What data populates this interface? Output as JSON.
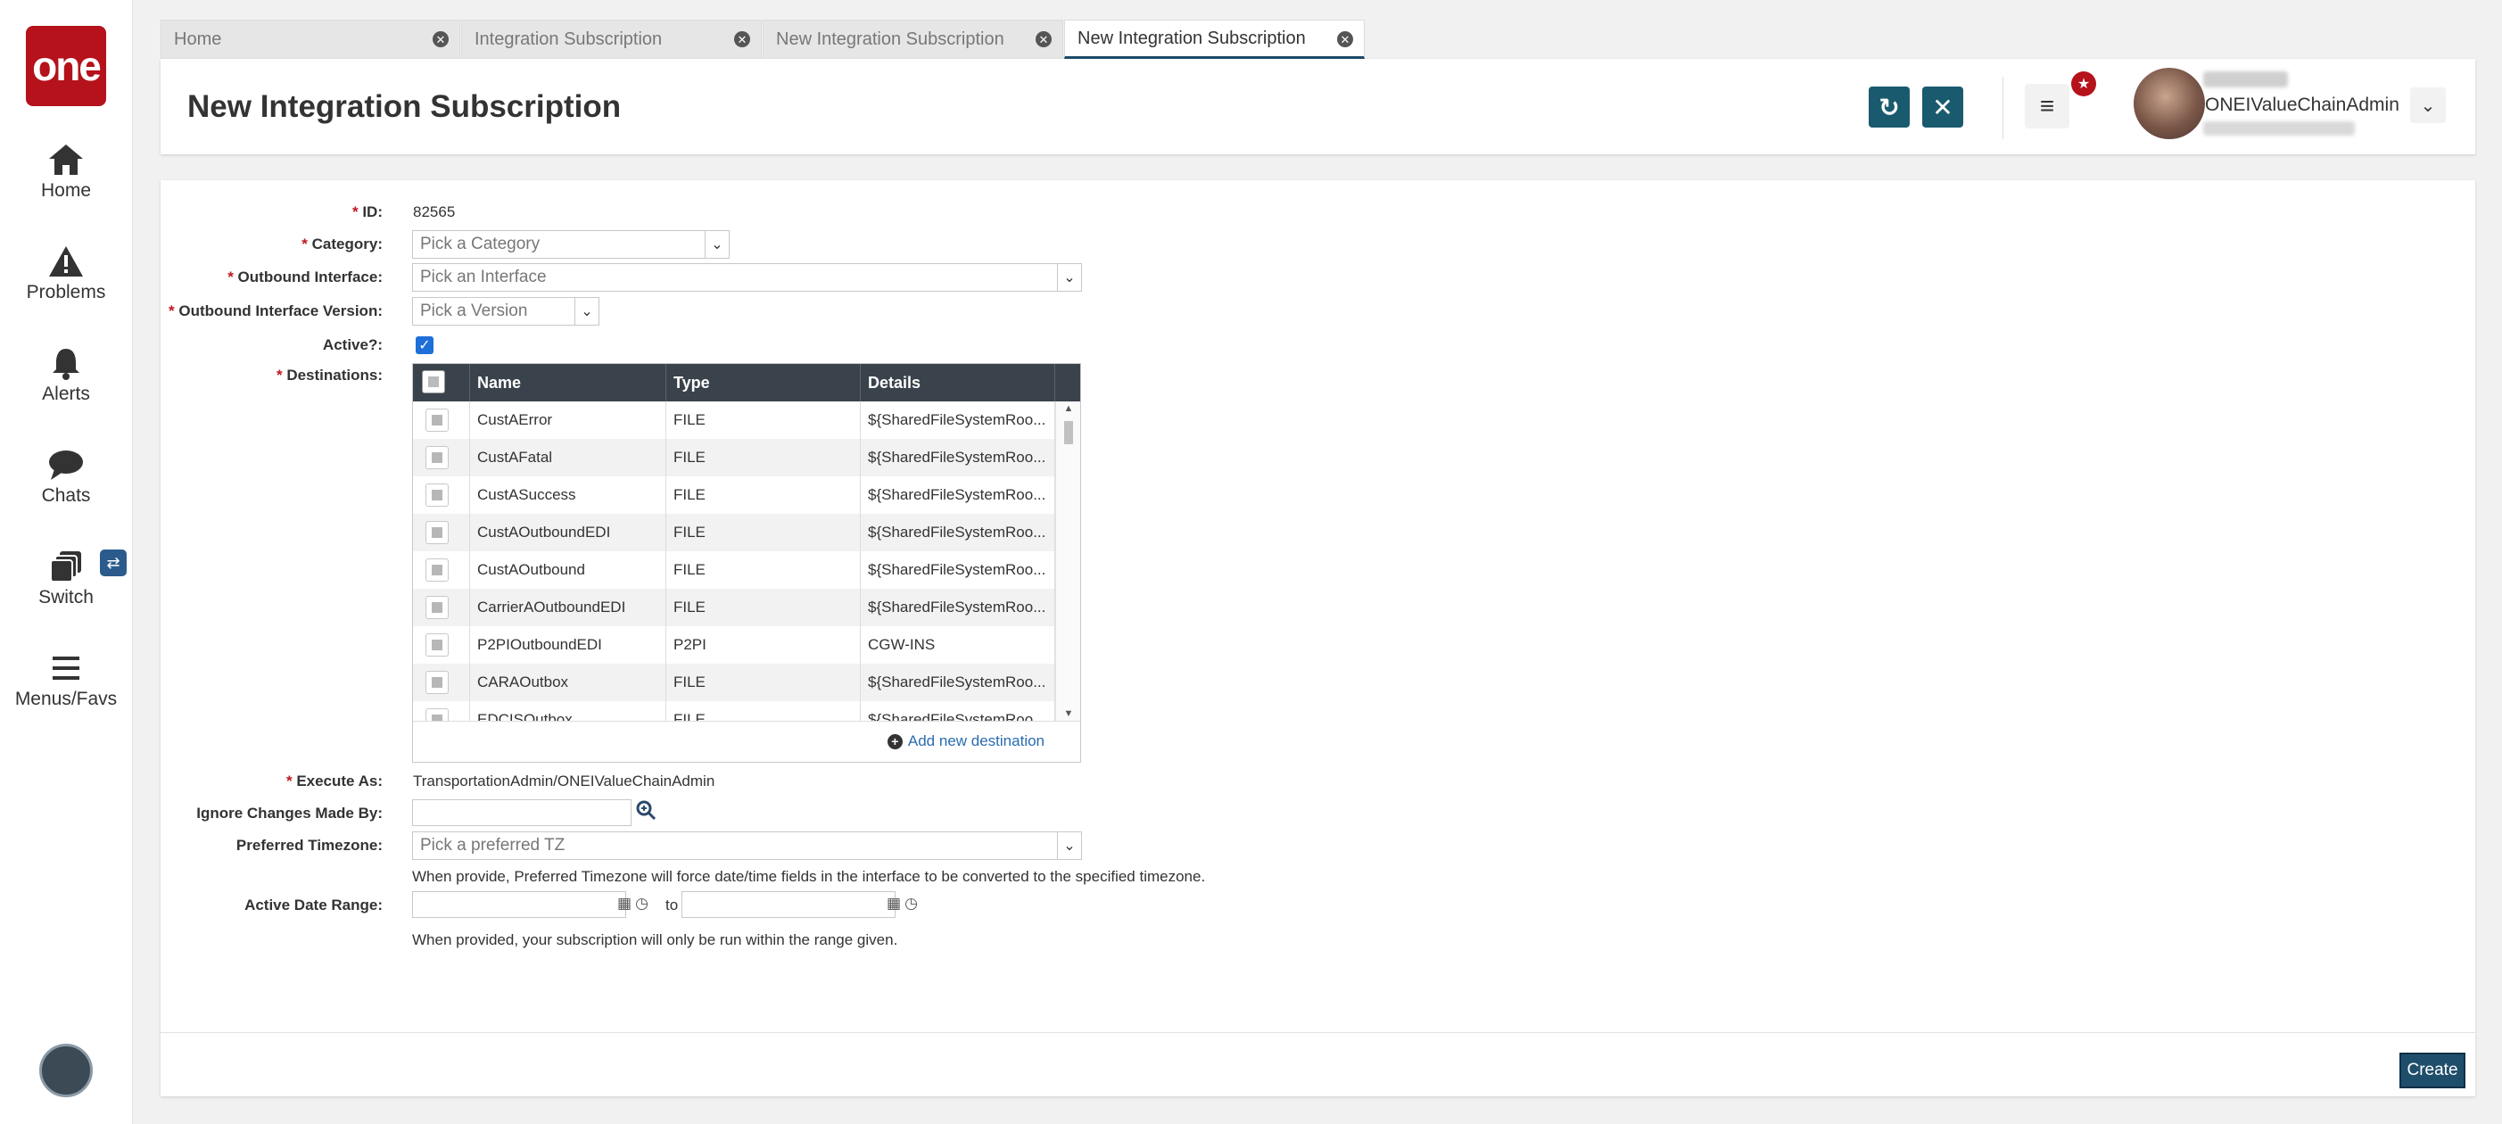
{
  "nav": {
    "logo": "one",
    "items": [
      {
        "label": "Home",
        "icon": "home-icon"
      },
      {
        "label": "Problems",
        "icon": "warning-icon"
      },
      {
        "label": "Alerts",
        "icon": "bell-icon"
      },
      {
        "label": "Chats",
        "icon": "chat-icon"
      },
      {
        "label": "Switch",
        "icon": "switch-icon"
      },
      {
        "label": "Menus/Favs",
        "icon": "hamburger-icon"
      }
    ],
    "switch_badge": "⇄"
  },
  "tabs": [
    {
      "label": "Home",
      "active": false
    },
    {
      "label": "Integration Subscription",
      "active": false
    },
    {
      "label": "New Integration Subscription",
      "active": false
    },
    {
      "label": "New Integration Subscription",
      "active": true
    }
  ],
  "header": {
    "title": "New Integration Subscription",
    "refresh_icon": "↻",
    "close_icon": "✕",
    "menu_icon": "≡",
    "notif_icon": "★",
    "user_role": "ONEIValueChainAdmin",
    "user_dropdown": "⌄"
  },
  "form": {
    "id": {
      "label": "ID:",
      "value": "82565"
    },
    "category": {
      "label": "Category:",
      "placeholder": "Pick a Category"
    },
    "outbound_interface": {
      "label": "Outbound Interface:",
      "placeholder": "Pick an Interface"
    },
    "outbound_interface_version": {
      "label": "Outbound Interface Version:",
      "placeholder": "Pick a Version"
    },
    "active": {
      "label": "Active?:",
      "checked": true,
      "checkmark": "✓"
    },
    "destinations": {
      "label": "Destinations:",
      "columns": [
        "Name",
        "Type",
        "Details"
      ],
      "rows": [
        {
          "name": "CustAError",
          "type": "FILE",
          "details": "${SharedFileSystemRoo..."
        },
        {
          "name": "CustAFatal",
          "type": "FILE",
          "details": "${SharedFileSystemRoo..."
        },
        {
          "name": "CustASuccess",
          "type": "FILE",
          "details": "${SharedFileSystemRoo..."
        },
        {
          "name": "CustAOutboundEDI",
          "type": "FILE",
          "details": "${SharedFileSystemRoo..."
        },
        {
          "name": "CustAOutbound",
          "type": "FILE",
          "details": "${SharedFileSystemRoo..."
        },
        {
          "name": "CarrierAOutboundEDI",
          "type": "FILE",
          "details": "${SharedFileSystemRoo..."
        },
        {
          "name": "P2PIOutboundEDI",
          "type": "P2PI",
          "details": "CGW-INS"
        },
        {
          "name": "CARAOutbox",
          "type": "FILE",
          "details": "${SharedFileSystemRoo..."
        },
        {
          "name": "EDCISOutbox",
          "type": "FILE",
          "details": "${SharedFileSystemRoo..."
        }
      ],
      "add_new": "Add new destination",
      "add_icon": "+"
    },
    "execute_as": {
      "label": "Execute As:",
      "value": "TransportationAdmin/ONEIValueChainAdmin"
    },
    "ignore_changes": {
      "label": "Ignore Changes Made By:",
      "value": ""
    },
    "preferred_timezone": {
      "label": "Preferred Timezone:",
      "placeholder": "Pick a preferred TZ",
      "help": "When provide, Preferred Timezone will force date/time fields in the interface to be converted to the specified timezone."
    },
    "active_date_range": {
      "label": "Active Date Range:",
      "to": "to",
      "help": "When provided, your subscription will only be run within the range given."
    },
    "required_mark": "*"
  },
  "footer": {
    "create_label": "Create"
  },
  "colors": {
    "brand": "#b5121b",
    "accent": "#1a5a6e",
    "grid_header": "#3a424b",
    "link": "#2a6cb0"
  }
}
